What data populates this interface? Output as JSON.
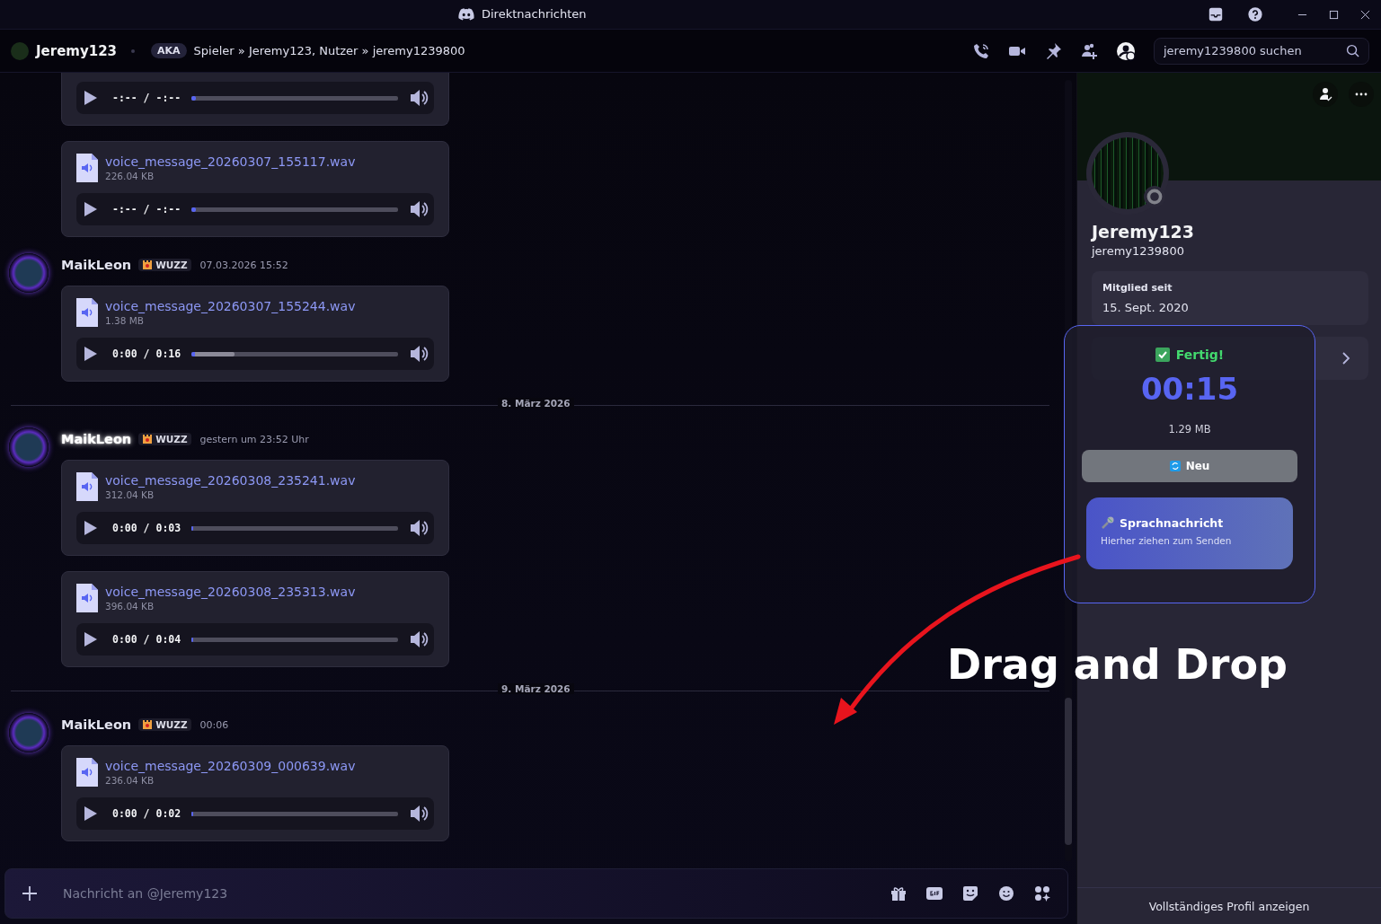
{
  "window": {
    "title": "Direktnachrichten"
  },
  "header": {
    "name": "Jeremy123",
    "aka": "AKA",
    "aliases": "Spieler » Jeremy123, Nutzer » jeremy1239800",
    "search": {
      "placeholder": "jeremy1239800 suchen"
    }
  },
  "feed": [
    {
      "kind": "audio",
      "time": "-:-- / -:--",
      "level": 0.02
    },
    {
      "kind": "audio",
      "file": "voice_message_20260307_155117.wav",
      "size": "226.04 KB",
      "time": "-:-- / -:--",
      "level": 0.02
    },
    {
      "kind": "group",
      "author": "MaikLeon",
      "tag": "WUZZ",
      "timestamp": "07.03.2026 15:52",
      "highlighted": false,
      "attachments": [
        {
          "file": "voice_message_20260307_155244.wav",
          "size": "1.38 MB",
          "time": "0:00 / 0:16",
          "level": 0.21
        }
      ]
    },
    {
      "kind": "divider",
      "label": "8. März 2026"
    },
    {
      "kind": "group",
      "author": "MaikLeon",
      "tag": "WUZZ",
      "timestamp": "gestern um 23:52 Uhr",
      "highlighted": true,
      "attachments": [
        {
          "file": "voice_message_20260308_235241.wav",
          "size": "312.04 KB",
          "time": "0:00 / 0:03",
          "level": 0.01
        },
        {
          "file": "voice_message_20260308_235313.wav",
          "size": "396.04 KB",
          "time": "0:00 / 0:04",
          "level": 0.01
        }
      ]
    },
    {
      "kind": "divider",
      "label": "9. März 2026"
    },
    {
      "kind": "group",
      "author": "MaikLeon",
      "tag": "WUZZ",
      "timestamp": "00:06",
      "highlighted": false,
      "attachments": [
        {
          "file": "voice_message_20260309_000639.wav",
          "size": "236.04 KB",
          "time": "0:00 / 0:02",
          "level": 0.01
        }
      ]
    }
  ],
  "composer": {
    "placeholder": "Nachricht an @Jeremy123"
  },
  "profile": {
    "name": "Jeremy123",
    "username": "jeremy1239800",
    "member_label": "Mitglied seit",
    "member_since": "15. Sept. 2020",
    "footer": "Vollständiges Profil anzeigen"
  },
  "recorder": {
    "status": "Fertig!",
    "timer": "00:15",
    "size": "1.29 MB",
    "new_button": "Neu",
    "drag_title": "Sprachnachricht",
    "drag_hint": "Hierher ziehen zum Senden"
  },
  "annotation": {
    "text": "Drag and Drop"
  }
}
